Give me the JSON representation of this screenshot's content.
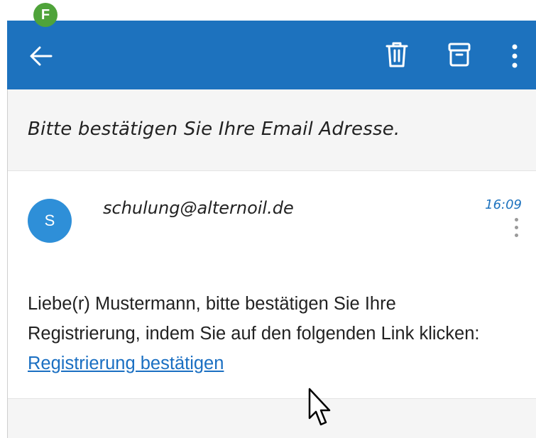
{
  "badge": {
    "letter": "F",
    "color": "#4fa33a"
  },
  "appbar": {
    "color": "#1d72be",
    "back_icon": "arrow-left-icon",
    "actions": [
      "trash-icon",
      "archive-icon",
      "more-vert-icon"
    ]
  },
  "email": {
    "subject": "Bitte bestätigen Sie Ihre Email Adresse.",
    "avatar_letter": "S",
    "sender": "schulung@alternoil.de",
    "time": "16:09",
    "body_text": "Liebe(r) Mustermann, bitte bestätigen Sie Ihre Registrierung, indem Sie auf den folgenden Link klicken: ",
    "link_text": "Registrierung bestätigen"
  }
}
